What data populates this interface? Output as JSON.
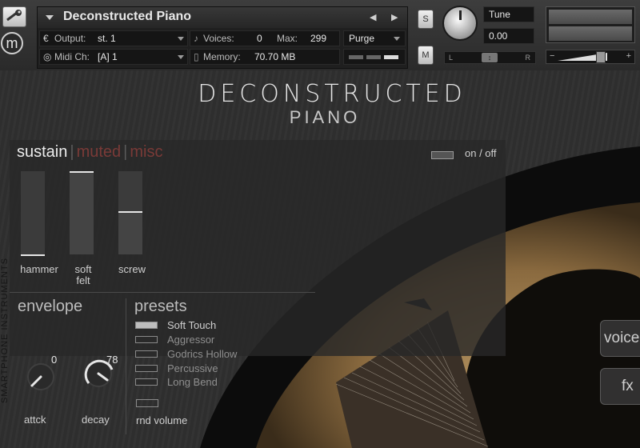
{
  "header": {
    "instrument_name": "Deconstructed Piano",
    "output_label": "Output:",
    "output_value": "st. 1",
    "voices_label": "Voices:",
    "voices_value": "0",
    "max_label": "Max:",
    "max_value": "299",
    "purge_label": "Purge",
    "midi_label": "Midi Ch:",
    "midi_value": "[A]  1",
    "memory_label": "Memory:",
    "memory_value": "70.70 MB",
    "solo_label": "S",
    "mute_label": "M",
    "tune_label": "Tune",
    "tune_value": "0.00",
    "pan_left": "L",
    "pan_right": "R",
    "vol_minus": "−",
    "vol_plus": "+"
  },
  "brand": {
    "title": "DECONSTRUCTED",
    "subtitle": "PIANO"
  },
  "side_text": "SMARTPHONE INSTRUMENTS",
  "tabs": [
    {
      "label": "sustain"
    },
    {
      "label": "muted"
    },
    {
      "label": "misc"
    }
  ],
  "on_off_label": "on / off",
  "sliders": [
    {
      "label": "hammer",
      "level": 0.0
    },
    {
      "label": "soft felt",
      "level": 1.0
    },
    {
      "label": "screw",
      "level": 0.52
    }
  ],
  "envelope": {
    "title": "envelope",
    "attack_label": "attck",
    "attack_value": "0",
    "decay_label": "decay",
    "decay_value": "78"
  },
  "presets": {
    "title": "presets",
    "items": [
      "Soft Touch",
      "Aggressor",
      "Godrics Hollow",
      "Percussive",
      "Long Bend"
    ],
    "selected": "Soft Touch",
    "rnd_label": "rnd volume"
  },
  "side_buttons": {
    "voice": "voice",
    "fx": "fx"
  },
  "colors": {
    "accent_dim": "#7a3a37",
    "active": "#ececec"
  }
}
